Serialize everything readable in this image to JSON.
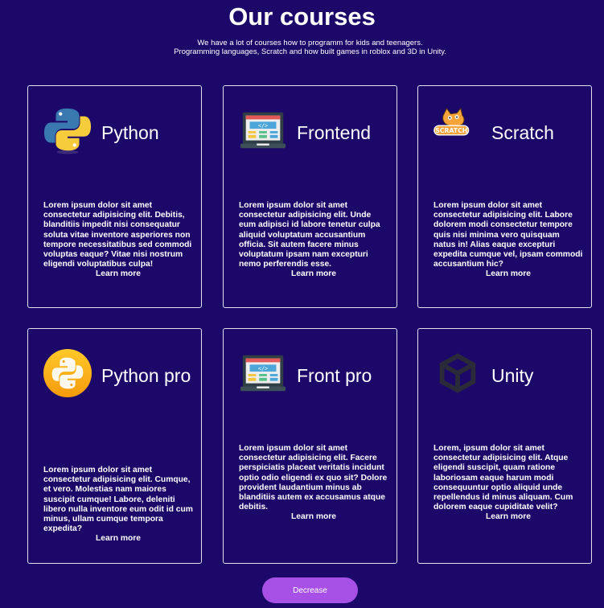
{
  "header": {
    "title": "Our courses",
    "subtitle_line1": "We have a lot of courses how to programm for kids and teenagers.",
    "subtitle_line2": "Programming languages, Scratch and how built games in roblox and 3D in Unity."
  },
  "courses": [
    {
      "name": "Python",
      "icon": "python-logo-icon",
      "description": "Lorem ipsum dolor sit amet consectetur adipisicing elit. Debitis, blanditiis impedit nisi consequatur soluta vitae inventore asperiores non tempore necessitatibus sed commodi voluptas eaque? Vitae nisi nostrum eligendi voluptatibus culpa!",
      "link": "Learn more"
    },
    {
      "name": "Frontend",
      "icon": "laptop-code-icon",
      "description": "Lorem ipsum dolor sit amet consectetur adipisicing elit. Unde eum adipisci id labore tenetur culpa aliquid voluptatum accusantium officia. Sit autem facere minus voluptatum ipsam nam excepturi nemo perferendis esse.",
      "link": "Learn more"
    },
    {
      "name": "Scratch",
      "icon": "scratch-cat-icon",
      "description": "Lorem ipsum dolor sit amet consectetur adipisicing elit. Labore dolorem modi consectetur tempore quis nisi minima vero quisquam natus in! Alias eaque excepturi expedita cumque vel, ipsam commodi accusantium hic?",
      "link": "Learn more"
    },
    {
      "name": "Python pro",
      "icon": "python-pro-icon",
      "description": "Lorem ipsum dolor sit amet consectetur adipisicing elit. Cumque, et vero. Molestias nam maiores suscipit cumque! Labore, deleniti libero nulla inventore eum odit id cum minus, ullam cumque tempora expedita?",
      "link": "Learn more"
    },
    {
      "name": "Front pro",
      "icon": "laptop-code-icon",
      "description": "Lorem ipsum dolor sit amet consectetur adipisicing elit. Facere perspiciatis placeat veritatis incidunt optio odio eligendi ex quo sit? Dolore provident laudantium minus ab blanditiis autem ex accusamus atque debitis.",
      "link": "Learn more"
    },
    {
      "name": "Unity",
      "icon": "unity-logo-icon",
      "description": "Lorem, ipsum dolor sit amet consectetur adipisicing elit. Atque eligendi suscipit, quam ratione laboriosam eaque harum modi consequuntur optio aliquid unde repellendus id minus aliquam. Cum dolorem eaque cupiditate velit?",
      "link": "Learn more"
    }
  ],
  "actions": {
    "decrease_label": "Decrease"
  },
  "colors": {
    "background": "#1b0868",
    "card_border": "#e3e0f0",
    "button": "#a650e6"
  }
}
